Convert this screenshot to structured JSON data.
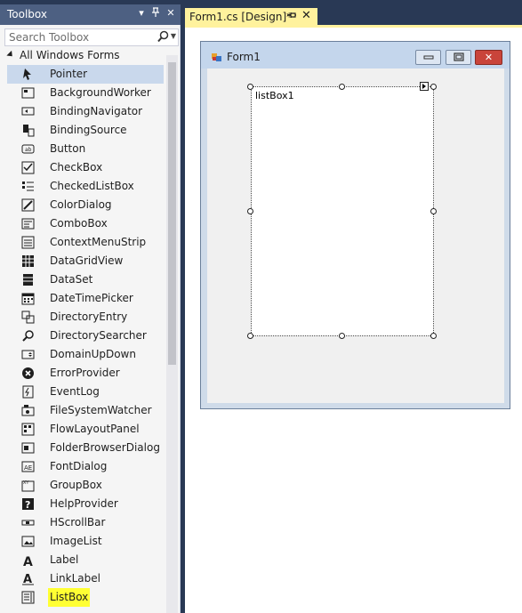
{
  "toolbox": {
    "title": "Toolbox",
    "title_controls": [
      "▾",
      "ᵖ",
      "✕"
    ],
    "search_placeholder": "Search Toolbox",
    "group_header": "All Windows Forms",
    "items": [
      {
        "label": "Pointer",
        "icon": "pointer-icon",
        "selected": true
      },
      {
        "label": "BackgroundWorker",
        "icon": "backgroundworker-icon"
      },
      {
        "label": "BindingNavigator",
        "icon": "bindingnavigator-icon"
      },
      {
        "label": "BindingSource",
        "icon": "bindingsource-icon"
      },
      {
        "label": "Button",
        "icon": "button-icon"
      },
      {
        "label": "CheckBox",
        "icon": "checkbox-icon"
      },
      {
        "label": "CheckedListBox",
        "icon": "checkedlistbox-icon"
      },
      {
        "label": "ColorDialog",
        "icon": "colordialog-icon"
      },
      {
        "label": "ComboBox",
        "icon": "combobox-icon"
      },
      {
        "label": "ContextMenuStrip",
        "icon": "contextmenustrip-icon"
      },
      {
        "label": "DataGridView",
        "icon": "datagridview-icon"
      },
      {
        "label": "DataSet",
        "icon": "dataset-icon"
      },
      {
        "label": "DateTimePicker",
        "icon": "datetimepicker-icon"
      },
      {
        "label": "DirectoryEntry",
        "icon": "directoryentry-icon"
      },
      {
        "label": "DirectorySearcher",
        "icon": "directorysearcher-icon"
      },
      {
        "label": "DomainUpDown",
        "icon": "domainupdown-icon"
      },
      {
        "label": "ErrorProvider",
        "icon": "errorprovider-icon"
      },
      {
        "label": "EventLog",
        "icon": "eventlog-icon"
      },
      {
        "label": "FileSystemWatcher",
        "icon": "filesystemwatcher-icon"
      },
      {
        "label": "FlowLayoutPanel",
        "icon": "flowlayoutpanel-icon"
      },
      {
        "label": "FolderBrowserDialog",
        "icon": "folderbrowserdialog-icon"
      },
      {
        "label": "FontDialog",
        "icon": "fontdialog-icon"
      },
      {
        "label": "GroupBox",
        "icon": "groupbox-icon"
      },
      {
        "label": "HelpProvider",
        "icon": "helpprovider-icon"
      },
      {
        "label": "HScrollBar",
        "icon": "hscrollbar-icon"
      },
      {
        "label": "ImageList",
        "icon": "imagelist-icon"
      },
      {
        "label": "Label",
        "icon": "label-icon"
      },
      {
        "label": "LinkLabel",
        "icon": "linklabel-icon"
      },
      {
        "label": "ListBox",
        "icon": "listbox-icon",
        "highlighted": true
      }
    ]
  },
  "document_tab": {
    "title": "Form1.cs [Design]*",
    "pin_glyph": "ᵖ",
    "close_glyph": "✕"
  },
  "form": {
    "title": "Form1",
    "minimize_glyph": "▭",
    "maximize_glyph": "▢",
    "close_glyph": "✕",
    "listbox_text": "listBox1"
  },
  "colors": {
    "toolbox_title_bg": "#4d6082",
    "active_tab_bg": "#fff29d",
    "selected_item_bg": "#c9d8ec",
    "highlight": "#ffff33"
  }
}
